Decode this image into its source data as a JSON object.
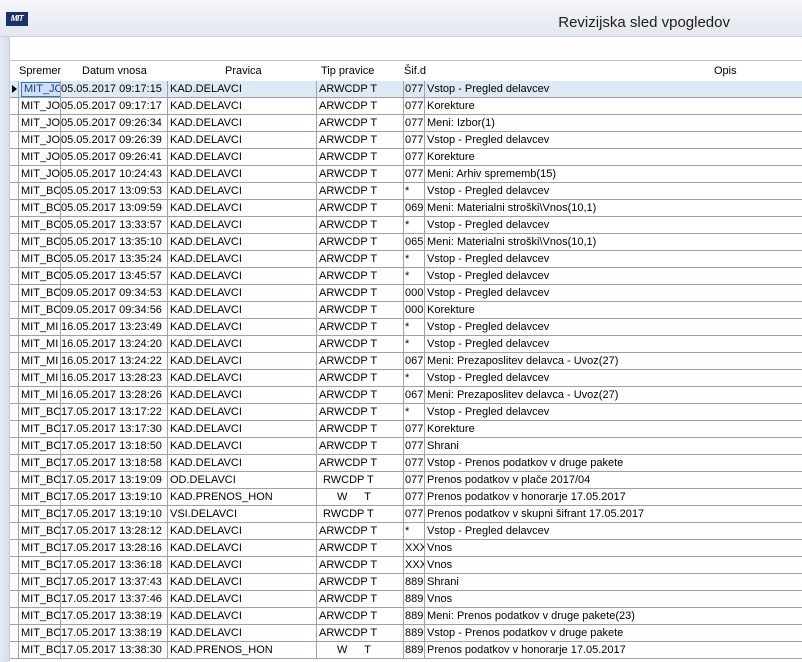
{
  "window": {
    "title": "Revizijska sled vpogledov",
    "logo_text": "MIT"
  },
  "columns": {
    "user": "Spremenil",
    "date": "Datum vnosa",
    "pravica": "Pravica",
    "tip": "Tip pravice",
    "sif": "Šif.d",
    "opis": "Opis"
  },
  "selected_row": 0,
  "rows": [
    {
      "user": "MIT_JO",
      "date": "05.05.2017 09:17:15",
      "pravica": "KAD.DELAVCI",
      "tip": "ARWCDP T",
      "sif": "077",
      "opis": "Vstop - Pregled delavcev"
    },
    {
      "user": "MIT_JO",
      "date": "05.05.2017 09:17:17",
      "pravica": "KAD.DELAVCI",
      "tip": "ARWCDP T",
      "sif": "077",
      "opis": "Korekture"
    },
    {
      "user": "MIT_JO",
      "date": "05.05.2017 09:26:34",
      "pravica": "KAD.DELAVCI",
      "tip": "ARWCDP T",
      "sif": "077",
      "opis": "Meni: Izbor(1)"
    },
    {
      "user": "MIT_JO",
      "date": "05.05.2017 09:26:39",
      "pravica": "KAD.DELAVCI",
      "tip": "ARWCDP T",
      "sif": "077",
      "opis": "Vstop - Pregled delavcev"
    },
    {
      "user": "MIT_JO",
      "date": "05.05.2017 09:26:41",
      "pravica": "KAD.DELAVCI",
      "tip": "ARWCDP T",
      "sif": "077",
      "opis": "Korekture"
    },
    {
      "user": "MIT_JO",
      "date": "05.05.2017 10:24:43",
      "pravica": "KAD.DELAVCI",
      "tip": "ARWCDP T",
      "sif": "077",
      "opis": "Meni: Arhiv sprememb(15)"
    },
    {
      "user": "MIT_BC",
      "date": "05.05.2017 13:09:53",
      "pravica": "KAD.DELAVCI",
      "tip": "ARWCDP T",
      "sif": "*",
      "opis": "Vstop - Pregled delavcev"
    },
    {
      "user": "MIT_BC",
      "date": "05.05.2017 13:09:59",
      "pravica": "KAD.DELAVCI",
      "tip": "ARWCDP T",
      "sif": "069",
      "opis": "Meni: Materialni stroški\\Vnos(10,1)"
    },
    {
      "user": "MIT_BC",
      "date": "05.05.2017 13:33:57",
      "pravica": "KAD.DELAVCI",
      "tip": "ARWCDP T",
      "sif": "*",
      "opis": "Vstop - Pregled delavcev"
    },
    {
      "user": "MIT_BC",
      "date": "05.05.2017 13:35:10",
      "pravica": "KAD.DELAVCI",
      "tip": "ARWCDP T",
      "sif": "065",
      "opis": "Meni: Materialni stroški\\Vnos(10,1)"
    },
    {
      "user": "MIT_BC",
      "date": "05.05.2017 13:35:24",
      "pravica": "KAD.DELAVCI",
      "tip": "ARWCDP T",
      "sif": "*",
      "opis": "Vstop - Pregled delavcev"
    },
    {
      "user": "MIT_BC",
      "date": "05.05.2017 13:45:57",
      "pravica": "KAD.DELAVCI",
      "tip": "ARWCDP T",
      "sif": "*",
      "opis": "Vstop - Pregled delavcev"
    },
    {
      "user": "MIT_BC",
      "date": "09.05.2017 09:34:53",
      "pravica": "KAD.DELAVCI",
      "tip": "ARWCDP T",
      "sif": "000",
      "opis": "Vstop - Pregled delavcev"
    },
    {
      "user": "MIT_BC",
      "date": "09.05.2017 09:34:56",
      "pravica": "KAD.DELAVCI",
      "tip": "ARWCDP T",
      "sif": "000",
      "opis": "Korekture"
    },
    {
      "user": "MIT_MI",
      "date": "16.05.2017 13:23:49",
      "pravica": "KAD.DELAVCI",
      "tip": "ARWCDP T",
      "sif": "*",
      "opis": "Vstop - Pregled delavcev"
    },
    {
      "user": "MIT_MI",
      "date": "16.05.2017 13:24:20",
      "pravica": "KAD.DELAVCI",
      "tip": "ARWCDP T",
      "sif": "*",
      "opis": "Vstop - Pregled delavcev"
    },
    {
      "user": "MIT_MI",
      "date": "16.05.2017 13:24:22",
      "pravica": "KAD.DELAVCI",
      "tip": "ARWCDP T",
      "sif": "067",
      "opis": "Meni: Prezaposlitev delavca - Uvoz(27)"
    },
    {
      "user": "MIT_MI",
      "date": "16.05.2017 13:28:23",
      "pravica": "KAD.DELAVCI",
      "tip": "ARWCDP T",
      "sif": "*",
      "opis": "Vstop - Pregled delavcev"
    },
    {
      "user": "MIT_MI",
      "date": "16.05.2017 13:28:26",
      "pravica": "KAD.DELAVCI",
      "tip": "ARWCDP T",
      "sif": "067",
      "opis": "Meni: Prezaposlitev delavca - Uvoz(27)"
    },
    {
      "user": "MIT_BC",
      "date": "17.05.2017 13:17:22",
      "pravica": "KAD.DELAVCI",
      "tip": "ARWCDP T",
      "sif": "*",
      "opis": "Vstop - Pregled delavcev"
    },
    {
      "user": "MIT_BC",
      "date": "17.05.2017 13:17:30",
      "pravica": "KAD.DELAVCI",
      "tip": "ARWCDP T",
      "sif": "077",
      "opis": "Korekture"
    },
    {
      "user": "MIT_BC",
      "date": "17.05.2017 13:18:50",
      "pravica": "KAD.DELAVCI",
      "tip": "ARWCDP T",
      "sif": "077",
      "opis": "Shrani"
    },
    {
      "user": "MIT_BC",
      "date": "17.05.2017 13:18:58",
      "pravica": "KAD.DELAVCI",
      "tip": "ARWCDP T",
      "sif": "077",
      "opis": "Vstop - Prenos podatkov v druge pakete"
    },
    {
      "user": "MIT_BC",
      "date": "17.05.2017 13:19:09",
      "pravica": "OD.DELAVCI",
      "tip": "RWCDP T",
      "sif": "077",
      "opis": "Prenos podatkov v plače 2017/04"
    },
    {
      "user": "MIT_BC",
      "date": "17.05.2017 13:19:10",
      "pravica": "KAD.PRENOS_HON",
      "tip": "W T",
      "sif": "077",
      "opis": "Prenos podatkov v honorarje 17.05.2017"
    },
    {
      "user": "MIT_BC",
      "date": "17.05.2017 13:19:10",
      "pravica": "VSI.DELAVCI",
      "tip": "RWCDP T",
      "sif": "077",
      "opis": "Prenos podatkov v skupni šifrant 17.05.2017"
    },
    {
      "user": "MIT_BC",
      "date": "17.05.2017 13:28:12",
      "pravica": "KAD.DELAVCI",
      "tip": "ARWCDP T",
      "sif": "*",
      "opis": "Vstop - Pregled delavcev"
    },
    {
      "user": "MIT_BC",
      "date": "17.05.2017 13:28:16",
      "pravica": "KAD.DELAVCI",
      "tip": "ARWCDP T",
      "sif": "XXX",
      "opis": "Vnos"
    },
    {
      "user": "MIT_BC",
      "date": "17.05.2017 13:36:18",
      "pravica": "KAD.DELAVCI",
      "tip": "ARWCDP T",
      "sif": "XXX",
      "opis": "Vnos"
    },
    {
      "user": "MIT_BC",
      "date": "17.05.2017 13:37:43",
      "pravica": "KAD.DELAVCI",
      "tip": "ARWCDP T",
      "sif": "889",
      "opis": "Shrani"
    },
    {
      "user": "MIT_BC",
      "date": "17.05.2017 13:37:46",
      "pravica": "KAD.DELAVCI",
      "tip": "ARWCDP T",
      "sif": "889",
      "opis": "Vnos"
    },
    {
      "user": "MIT_BC",
      "date": "17.05.2017 13:38:19",
      "pravica": "KAD.DELAVCI",
      "tip": "ARWCDP T",
      "sif": "889",
      "opis": "Meni: Prenos podatkov v druge pakete(23)"
    },
    {
      "user": "MIT_BC",
      "date": "17.05.2017 13:38:19",
      "pravica": "KAD.DELAVCI",
      "tip": "ARWCDP T",
      "sif": "889",
      "opis": "Vstop - Prenos podatkov v druge pakete"
    },
    {
      "user": "MIT_BC",
      "date": "17.05.2017 13:38:30",
      "pravica": "KAD.PRENOS_HON",
      "tip": "W T",
      "sif": "889",
      "opis": "Prenos podatkov v honorarje 17.05.2017"
    }
  ]
}
